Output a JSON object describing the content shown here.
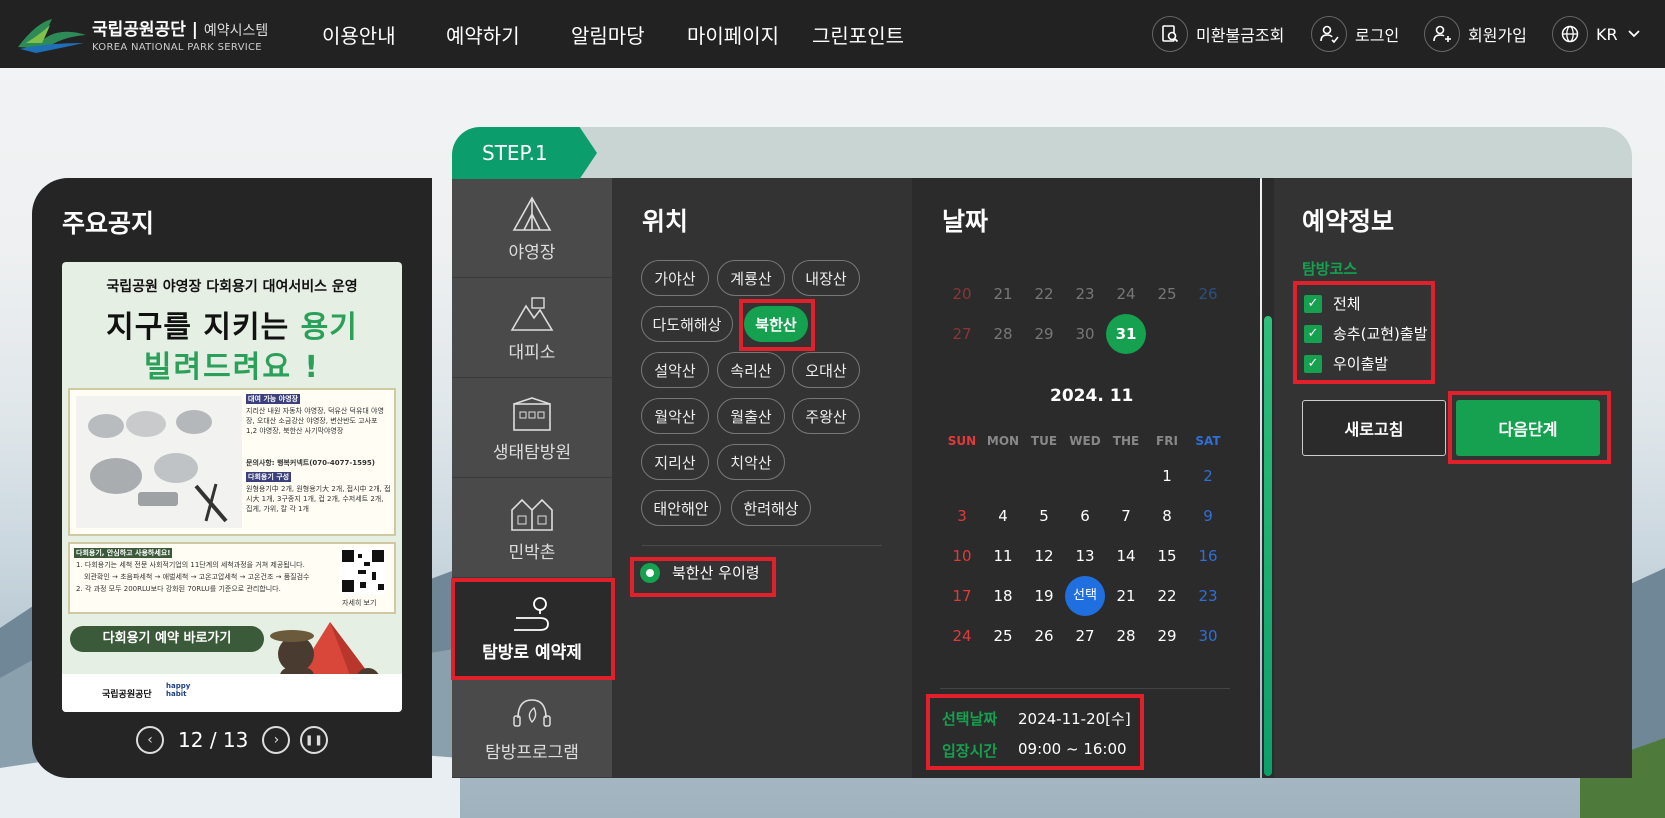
{
  "header": {
    "logo_title": "국립공원공단",
    "logo_system": "예약시스템",
    "logo_sub": "KOREA NATIONAL PARK SERVICE",
    "nav": [
      "이용안내",
      "예약하기",
      "알림마당",
      "마이페이지",
      "그린포인트"
    ],
    "util": [
      {
        "icon": "receipt-search-icon",
        "label": "미환불금조회"
      },
      {
        "icon": "user-login-icon",
        "label": "로그인"
      },
      {
        "icon": "user-add-icon",
        "label": "회원가입"
      },
      {
        "icon": "globe-icon",
        "label": "KR"
      }
    ]
  },
  "notice": {
    "title": "주요공지",
    "poster": {
      "line1": "국립공원 야영장 다회용기 대여서비스 운영",
      "line2a": "지구를 지키는",
      "line2b": "용기",
      "line3": "빌려드려요 !",
      "box1_heading": "대여 가능 야영장",
      "box1_text": "지리산 내원 자동차 야영장, 덕유산 덕유대 야영장, 오대산 소금강산 야영장, 변산반도 고사포 1,2 야영장, 북한산 사기막야영장",
      "box1_contact": "문의사항: 행복커넥트(070-4077-1595)",
      "box1_heading2": "다회용기 구성",
      "box1_text2": "원형용기中 2개, 원형용기大 2개, 접시中 2개, 접시大 1개, 3구종지 1개, 컵 2개, 수저세트 2개, 집게, 가위, 칼 각 1개",
      "box2_heading": "다회용기, 안심하고 사용하세요!",
      "box2_text1": "1. 다회용기는 세척 전문 사회적기업의 11단계의 세척과정을 거쳐 제공됩니다.",
      "box2_text2": "외관확인 → 초음파세척 → 애벌세척 → 고온고압세척 → 고온건조 → 품질검수",
      "box2_text3": "2. 각 과정 모두 200RLU보다 강화된 70RLU를 기준으로 관리합니다.",
      "box2_qr": "자세히 보기",
      "button": "다회용기 예약 바로가기",
      "footer_brand": "국립공원공단",
      "footer_habit": "happy habit"
    },
    "pager": {
      "current": "12",
      "sep": "/",
      "total": "13"
    }
  },
  "step": {
    "label": "STEP.1"
  },
  "categories": [
    {
      "label": "야영장",
      "icon": "tent-icon",
      "active": false
    },
    {
      "label": "대피소",
      "icon": "shelter-icon",
      "active": false
    },
    {
      "label": "생태탐방원",
      "icon": "eco-center-icon",
      "active": false
    },
    {
      "label": "민박촌",
      "icon": "houses-icon",
      "active": false
    },
    {
      "label": "탐방로 예약제",
      "icon": "trail-route-icon",
      "active": true
    },
    {
      "label": "탐방프로그램",
      "icon": "headset-leaf-icon",
      "active": false
    }
  ],
  "location": {
    "title": "위치",
    "chips": [
      "가야산",
      "계룡산",
      "내장산",
      "다도해해상",
      "북한산",
      "설악산",
      "속리산",
      "오대산",
      "월악산",
      "월출산",
      "주왕산",
      "지리산",
      "치악산",
      "태안해안",
      "한려해상"
    ],
    "selected": "북한산",
    "trail": "북한산 우이령"
  },
  "date": {
    "title": "날짜",
    "prev_rows": [
      [
        "20",
        "21",
        "22",
        "23",
        "24",
        "25",
        "26"
      ],
      [
        "27",
        "28",
        "29",
        "30",
        "31",
        "",
        ""
      ]
    ],
    "month": "2024. 11",
    "weekdays": [
      "SUN",
      "MON",
      "TUE",
      "WED",
      "THE",
      "FRI",
      "SAT"
    ],
    "rows": [
      [
        "",
        "",
        "",
        "",
        "",
        "1",
        "2"
      ],
      [
        "3",
        "4",
        "5",
        "6",
        "7",
        "8",
        "9"
      ],
      [
        "10",
        "11",
        "12",
        "13",
        "14",
        "15",
        "16"
      ],
      [
        "17",
        "18",
        "19",
        "선택",
        "21",
        "22",
        "23"
      ],
      [
        "24",
        "25",
        "26",
        "27",
        "28",
        "29",
        "30"
      ]
    ],
    "selected_label": "선택날짜",
    "selected_value": "2024-11-20[수]",
    "time_label": "입장시간",
    "time_value": "09:00 ~ 16:00"
  },
  "reservation": {
    "title": "예약정보",
    "course_label": "탐방코스",
    "courses": [
      "전체",
      "송추(교현)출발",
      "우이출발"
    ],
    "refresh": "새로고침",
    "next": "다음단계"
  },
  "colors": {
    "accent_green": "#15a150",
    "step_green": "#0b9d6b",
    "picked_blue": "#1f6fe0",
    "highlight_red": "#e0202a"
  }
}
